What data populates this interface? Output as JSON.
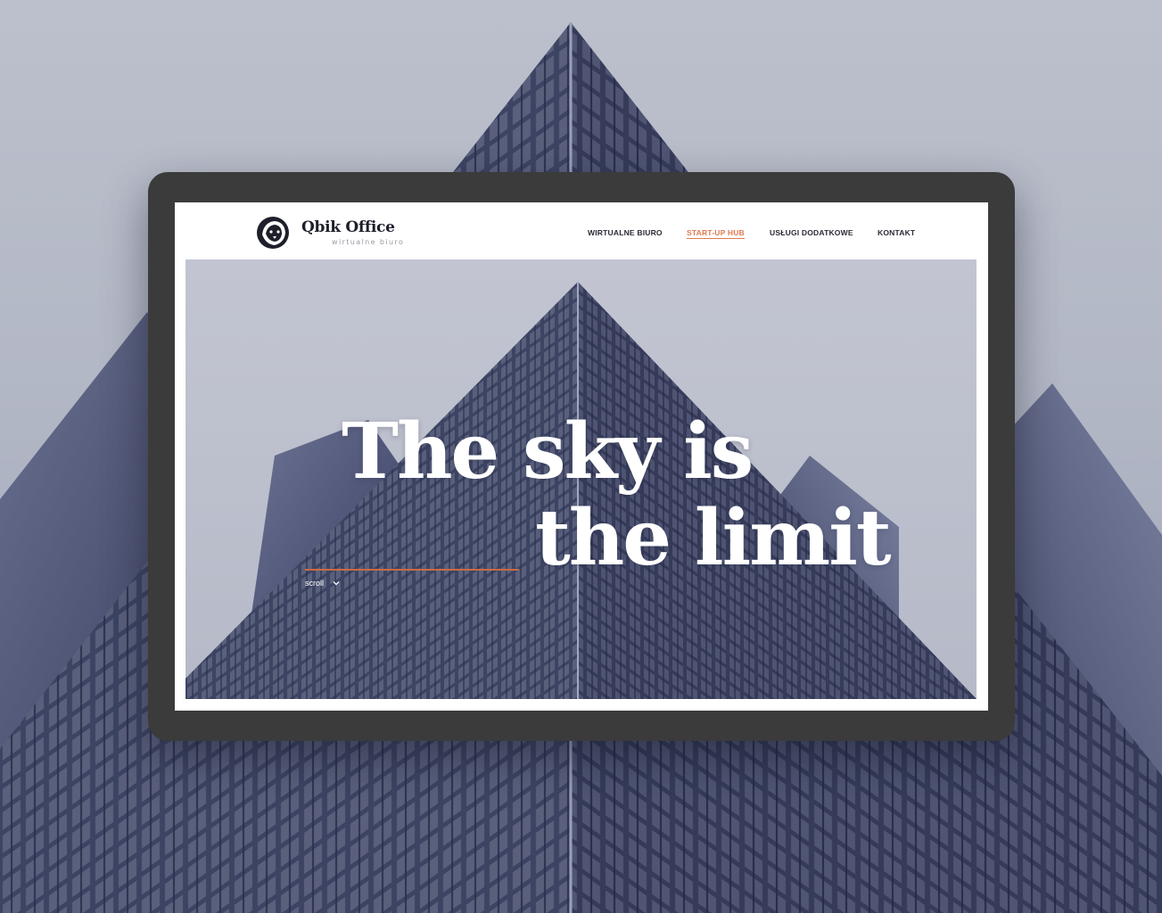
{
  "brand": {
    "name": "Qbik Office",
    "tagline": "wirtualne biuro"
  },
  "nav": {
    "items": [
      {
        "label": "WIRTUALNE BIURO",
        "active": false
      },
      {
        "label": "START-UP HUB",
        "active": true
      },
      {
        "label": "USŁUGI DODATKOWE",
        "active": false
      },
      {
        "label": "KONTAKT",
        "active": false
      }
    ]
  },
  "hero": {
    "headline_line1": "The sky is",
    "headline_line2": "the limit",
    "scroll_label": "scroll"
  },
  "icons": {
    "logo": "lion-head-icon",
    "scroll": "chevron-down-icon"
  },
  "colors": {
    "accent": "#e07a4f",
    "frame": "#3b3b3b",
    "building": "#3f4566"
  }
}
